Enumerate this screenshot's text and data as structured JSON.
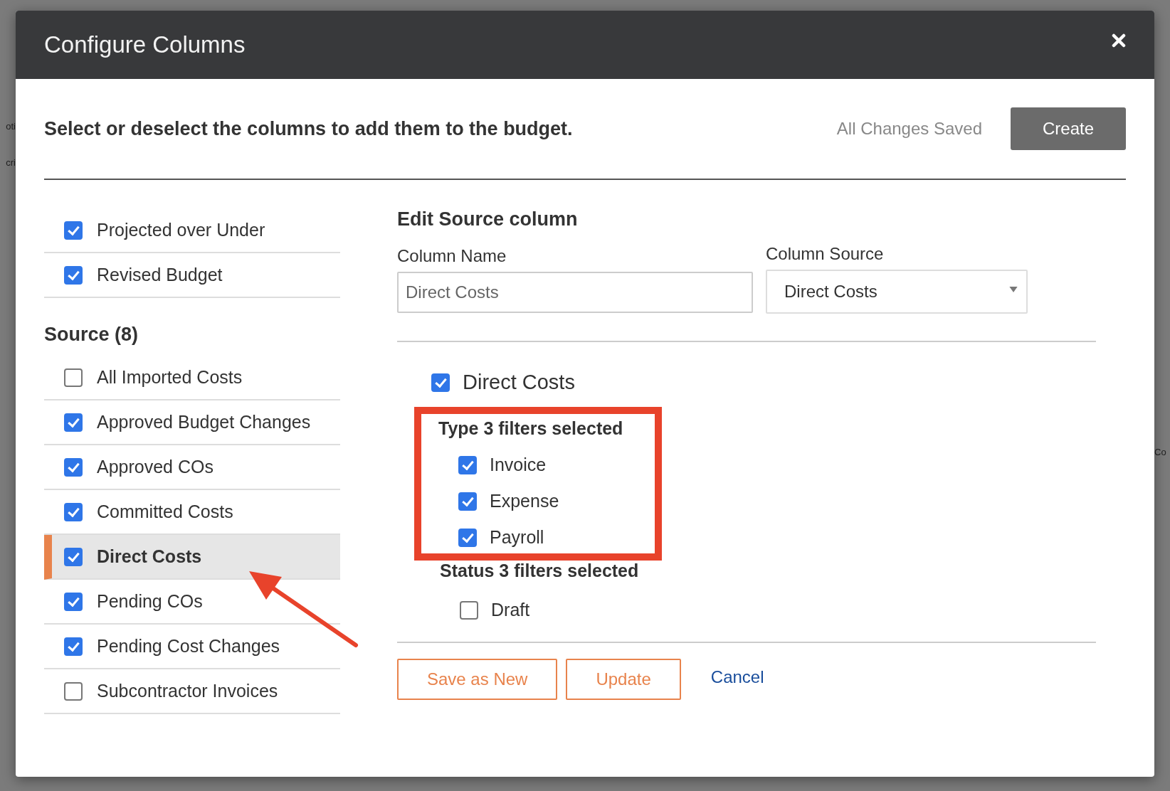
{
  "left_background_fragments": [
    "oti",
    "cri"
  ],
  "right_background_fragments": [
    "Co"
  ],
  "window": {
    "title": "Configure Columns"
  },
  "instruction": "Select or deselect the columns to add them to the budget.",
  "save_status": "All Changes Saved",
  "create_button": "Create",
  "column_groups": [
    {
      "items": [
        {
          "label": "Projected over Under",
          "checked": true,
          "selected": false
        },
        {
          "label": "Revised Budget",
          "checked": true,
          "selected": false
        }
      ]
    },
    {
      "heading": "Source (8)",
      "items": [
        {
          "label": "All Imported Costs",
          "checked": false,
          "selected": false
        },
        {
          "label": "Approved Budget Changes",
          "checked": true,
          "selected": false
        },
        {
          "label": "Approved COs",
          "checked": true,
          "selected": false
        },
        {
          "label": "Committed Costs",
          "checked": true,
          "selected": false
        },
        {
          "label": "Direct Costs",
          "checked": true,
          "selected": true
        },
        {
          "label": "Pending COs",
          "checked": true,
          "selected": false
        },
        {
          "label": "Pending Cost Changes",
          "checked": true,
          "selected": false
        },
        {
          "label": "Subcontractor Invoices",
          "checked": false,
          "selected": false
        }
      ]
    }
  ],
  "editor": {
    "heading": "Edit Source column",
    "column_name": {
      "label": "Column Name",
      "value": "Direct Costs"
    },
    "column_source": {
      "label": "Column Source",
      "value": "Direct Costs"
    },
    "source_toggle": {
      "label": "Direct Costs",
      "checked": true
    },
    "filter_groups": [
      {
        "heading": "Type 3 filters selected",
        "highlighted": true,
        "options": [
          {
            "label": "Invoice",
            "checked": true
          },
          {
            "label": "Expense",
            "checked": true
          },
          {
            "label": "Payroll",
            "checked": true
          }
        ]
      },
      {
        "heading": "Status 3 filters selected",
        "highlighted": false,
        "options": [
          {
            "label": "Draft",
            "checked": false
          }
        ]
      }
    ],
    "buttons": [
      {
        "label": "Save as New",
        "kind": "outline"
      },
      {
        "label": "Update",
        "kind": "outline"
      },
      {
        "label": "Cancel",
        "kind": "link"
      }
    ]
  }
}
